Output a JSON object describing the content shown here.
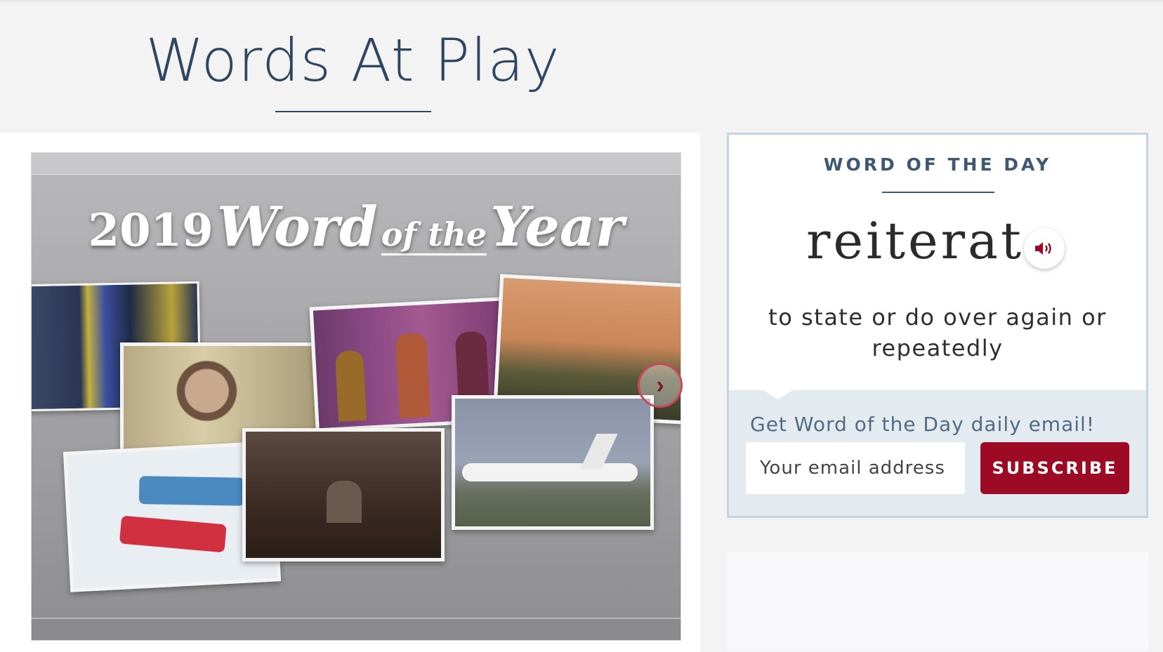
{
  "page": {
    "title": "Words At Play"
  },
  "feature": {
    "headline_year": "2019",
    "headline_word": "Word",
    "headline_ofthe": "of the",
    "headline_year_word": "Year",
    "carousel_next_glyph": "›"
  },
  "word_of_the_day": {
    "heading": "WORD OF THE DAY",
    "word": "reiterate",
    "definition": "to state or do over again or repeatedly",
    "audio_icon": "speaker-icon"
  },
  "signup": {
    "label": "Get Word of the Day daily email!",
    "email_placeholder": "Your email address",
    "subscribe_label": "SUBSCRIBE"
  },
  "colors": {
    "accent": "#9c0a23",
    "title": "#2f4661",
    "panel_border": "#c6d4e1",
    "signup_bg": "#e3ebf0"
  }
}
